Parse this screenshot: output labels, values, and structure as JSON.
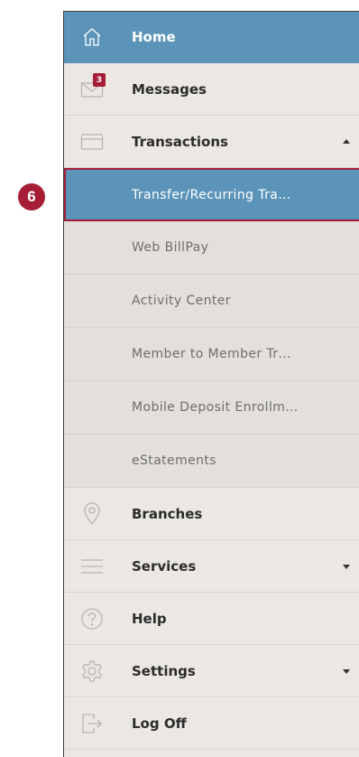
{
  "callout": {
    "number": "6"
  },
  "menu": {
    "home": {
      "label": "Home",
      "icon": "home-icon"
    },
    "messages": {
      "label": "Messages",
      "badge": "3",
      "icon": "envelope-icon"
    },
    "transactions": {
      "label": "Transactions",
      "icon": "card-icon",
      "expanded": true,
      "sub_items": [
        {
          "label": "Transfer/Recurring Tra…",
          "active": true
        },
        {
          "label": "Web BillPay"
        },
        {
          "label": "Activity Center"
        },
        {
          "label": "Member to Member Tr…"
        },
        {
          "label": "Mobile Deposit Enrollm…"
        },
        {
          "label": "eStatements"
        }
      ]
    },
    "branches": {
      "label": "Branches",
      "icon": "location-pin-icon"
    },
    "services": {
      "label": "Services",
      "icon": "menu-lines-icon"
    },
    "help": {
      "label": "Help",
      "icon": "question-circle-icon"
    },
    "settings": {
      "label": "Settings",
      "icon": "gear-icon"
    },
    "logoff": {
      "label": "Log Off",
      "icon": "logout-icon"
    }
  },
  "colors": {
    "accent_blue": "#5b94b8",
    "highlight_red": "#a51e36",
    "menu_bg": "#ebe8e4",
    "submenu_bg": "#e3e0dc"
  }
}
